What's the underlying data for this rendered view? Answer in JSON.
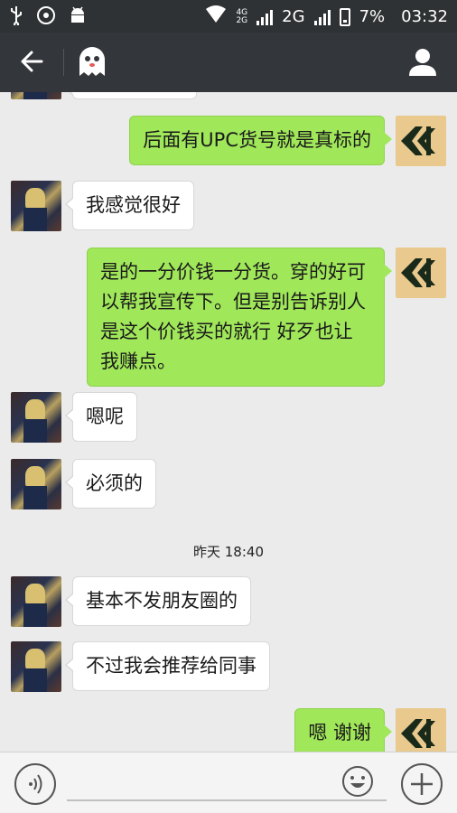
{
  "status_bar": {
    "network_small": "4G\n2G",
    "network": "2G",
    "battery": "7%",
    "time": "03:32"
  },
  "header": {
    "back_icon": "arrow-left-icon",
    "contact_avatar_icon": "ghost-icon",
    "profile_icon": "person-icon"
  },
  "messages": [
    {
      "side": "right",
      "text": "后面有UPC货号就是真标的"
    },
    {
      "side": "left",
      "text": "我感觉很好"
    },
    {
      "side": "right",
      "text": "是的一分价钱一分货。穿的好可以帮我宣传下。但是别告诉别人是这个价钱买的就行 好歹也让我赚点。"
    },
    {
      "side": "left",
      "text": "嗯呢"
    },
    {
      "side": "left",
      "text": "必须的"
    },
    {
      "side": "left",
      "text": "基本不发朋友圈的"
    },
    {
      "side": "left",
      "text": "不过我会推荐给同事"
    },
    {
      "side": "right",
      "text": "嗯 谢谢"
    }
  ],
  "timestamp": "昨天 18:40",
  "input_bar": {
    "voice_icon": "voice-icon",
    "emoji_icon": "emoji-icon",
    "plus_icon": "plus-icon"
  },
  "colors": {
    "header_bg": "#33363a",
    "status_bg": "#2f3234",
    "chat_bg": "#ebebeb",
    "sent_bubble": "#a0e75a",
    "received_bubble": "#ffffff"
  }
}
